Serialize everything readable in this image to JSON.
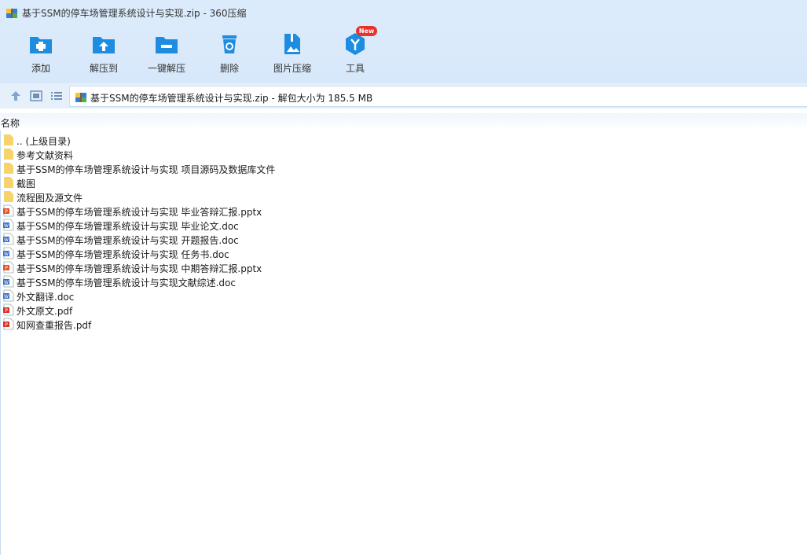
{
  "window": {
    "title": "基于SSM的停车场管理系统设计与实现.zip - 360压缩"
  },
  "toolbar": {
    "buttons": [
      {
        "label": "添加",
        "icon": "add-folder-icon"
      },
      {
        "label": "解压到",
        "icon": "extract-folder-icon"
      },
      {
        "label": "一键解压",
        "icon": "one-click-extract-icon"
      },
      {
        "label": "删除",
        "icon": "trash-icon"
      },
      {
        "label": "图片压缩",
        "icon": "image-compress-icon"
      },
      {
        "label": "工具",
        "icon": "tools-icon"
      }
    ],
    "badge": "New"
  },
  "address": {
    "text": "基于SSM的停车场管理系统设计与实现.zip - 解包大小为 185.5 MB"
  },
  "list": {
    "column_name": "名称",
    "items": [
      {
        "name": ".. (上级目录)",
        "type": "folder"
      },
      {
        "name": "参考文献资料",
        "type": "folder"
      },
      {
        "name": "基于SSM的停车场管理系统设计与实现 项目源码及数据库文件",
        "type": "folder"
      },
      {
        "name": "截图",
        "type": "folder"
      },
      {
        "name": "流程图及源文件",
        "type": "folder"
      },
      {
        "name": "基于SSM的停车场管理系统设计与实现 毕业答辩汇报.pptx",
        "type": "pptx"
      },
      {
        "name": "基于SSM的停车场管理系统设计与实现 毕业论文.doc",
        "type": "doc"
      },
      {
        "name": "基于SSM的停车场管理系统设计与实现 开题报告.doc",
        "type": "doc"
      },
      {
        "name": "基于SSM的停车场管理系统设计与实现 任务书.doc",
        "type": "doc"
      },
      {
        "name": "基于SSM的停车场管理系统设计与实现 中期答辩汇报.pptx",
        "type": "pptx"
      },
      {
        "name": "基于SSM的停车场管理系统设计与实现文献综述.doc",
        "type": "doc"
      },
      {
        "name": "外文翻译.doc",
        "type": "doc"
      },
      {
        "name": "外文原文.pdf",
        "type": "pdf"
      },
      {
        "name": "知网查重报告.pdf",
        "type": "pdf"
      }
    ]
  },
  "colors": {
    "accent": "#1e8ce0",
    "titlebar": "#dcebfb",
    "folder": "#f7d36b",
    "pptx": "#e0542b",
    "doc": "#3b6fc4",
    "pdf": "#d9322b"
  }
}
